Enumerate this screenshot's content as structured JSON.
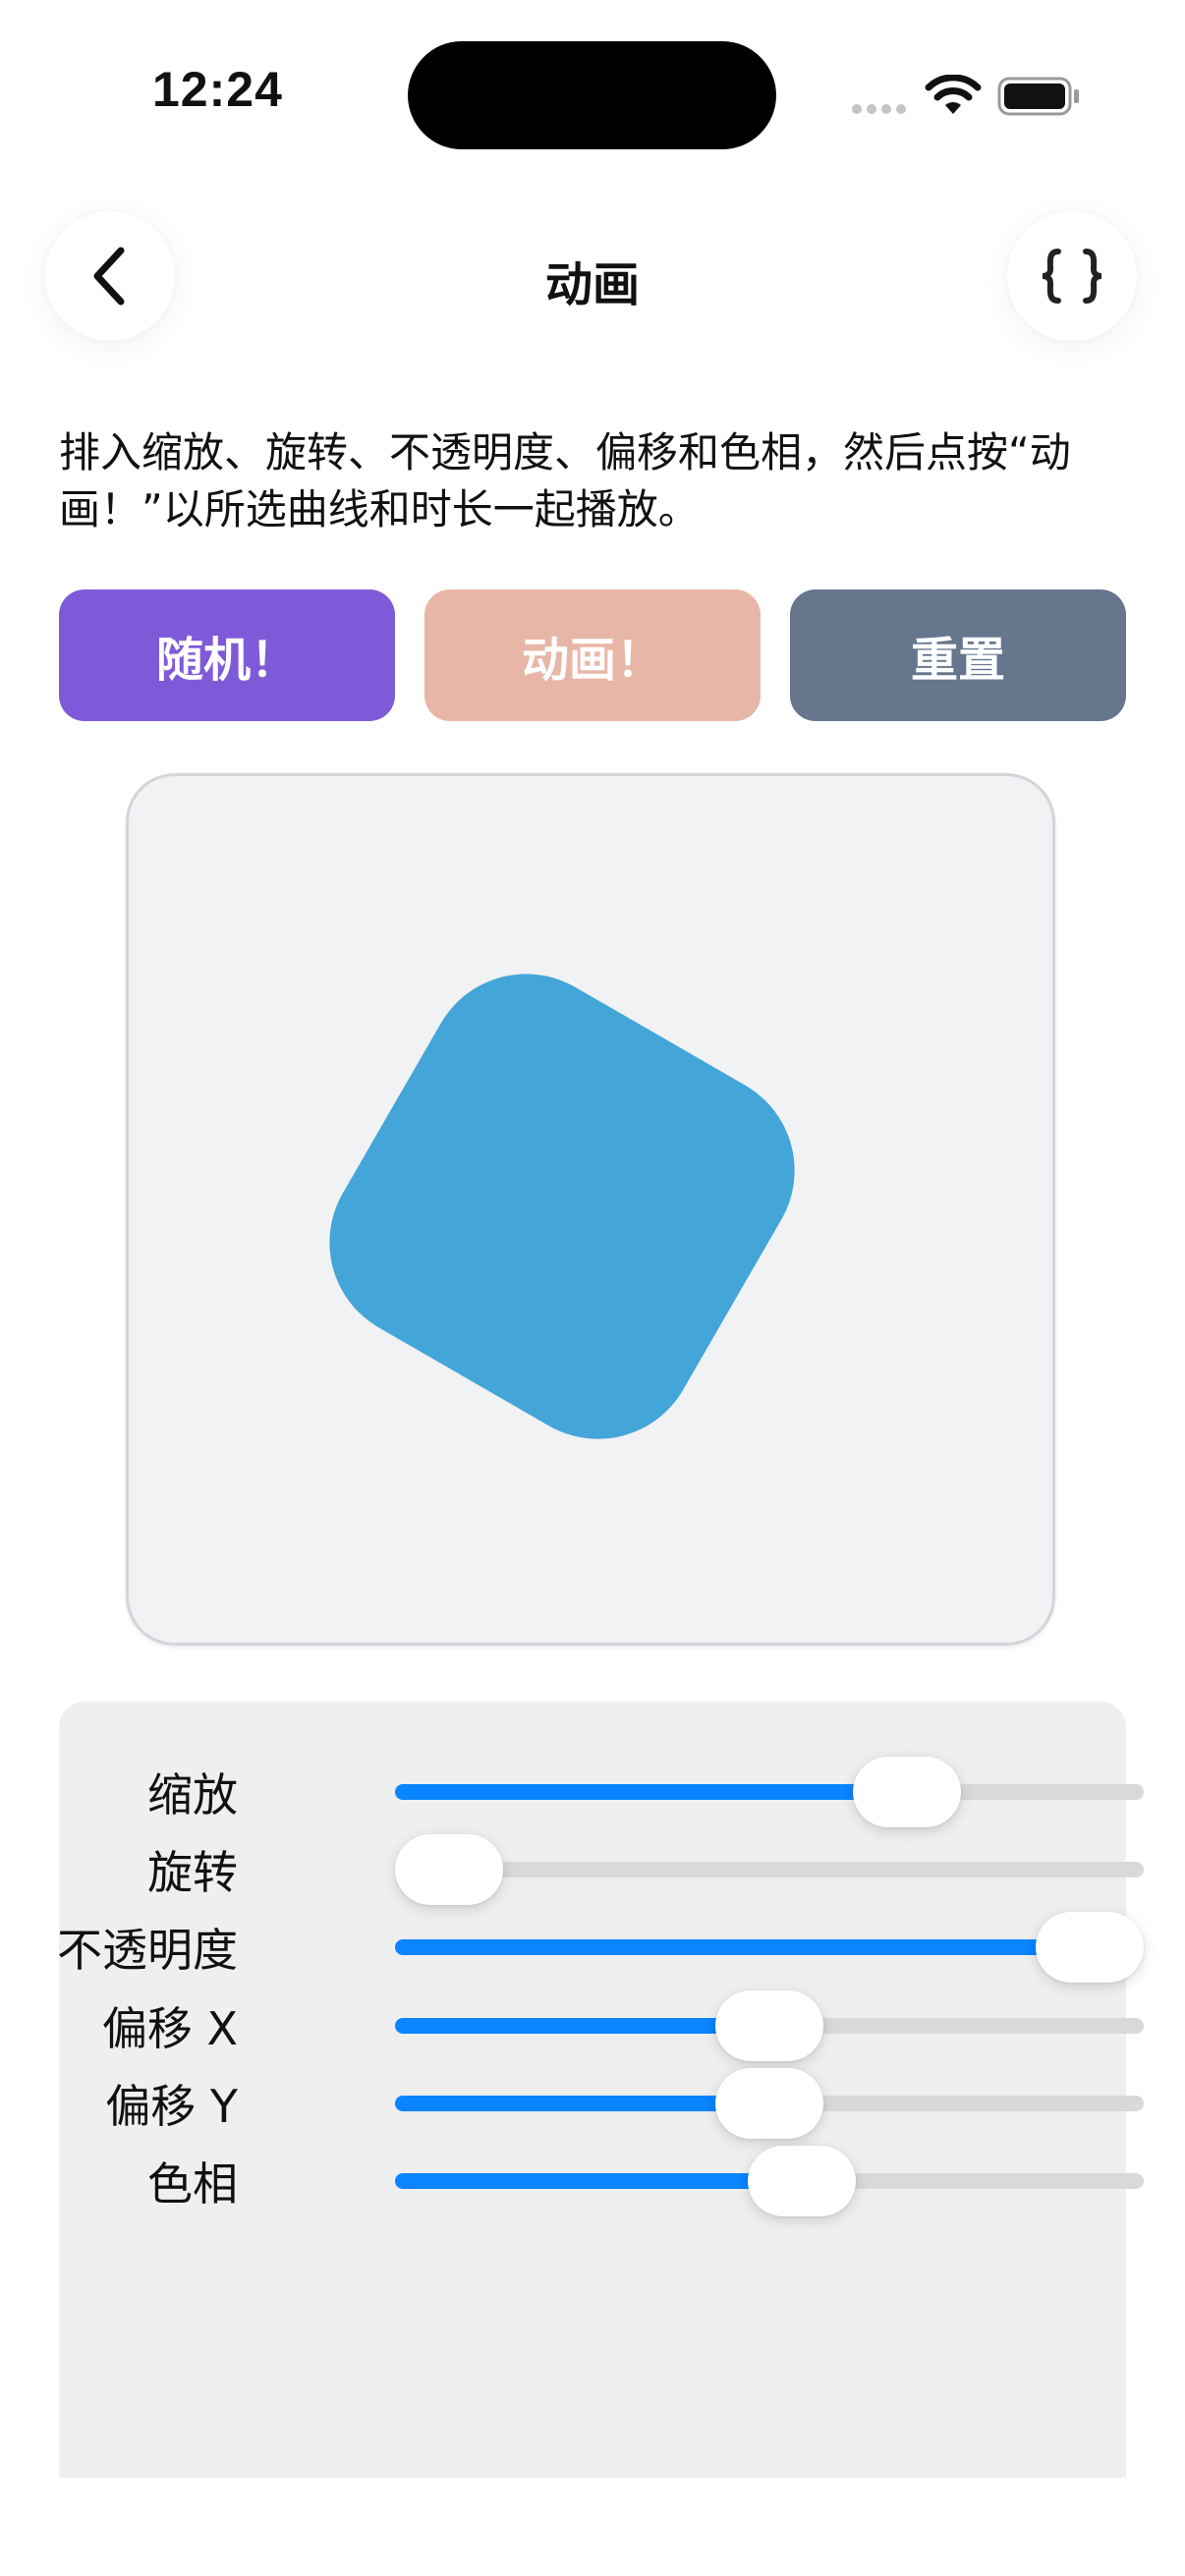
{
  "status_bar": {
    "time": "12:24"
  },
  "nav": {
    "title": "动画",
    "back_icon": "chevron-left-icon",
    "code_icon": "curly-braces-icon"
  },
  "description": "排入缩放、旋转、不透明度、偏移和色相，然后点按“动画！”以所选曲线和时长一起播放。",
  "buttons": {
    "random": {
      "label": "随机！",
      "color": "#7f5ad8"
    },
    "animate": {
      "label": "动画！",
      "color": "#e8b6a6"
    },
    "reset": {
      "label": "重置",
      "color": "#65768d"
    }
  },
  "preview": {
    "shape_color": "#43a5d8",
    "rotation_degrees": 30
  },
  "sliders": [
    {
      "label": "缩放",
      "value": 0.715
    },
    {
      "label": "旋转",
      "value": 0.0
    },
    {
      "label": "不透明度",
      "value": 1.0
    },
    {
      "label": "偏移 X",
      "value": 0.5
    },
    {
      "label": "偏移 Y",
      "value": 0.5
    },
    {
      "label": "色相",
      "value": 0.55
    }
  ],
  "colors": {
    "slider_active": "#0a84ff",
    "slider_inactive": "#d9d9dc",
    "panel_background": "#efeff0"
  }
}
